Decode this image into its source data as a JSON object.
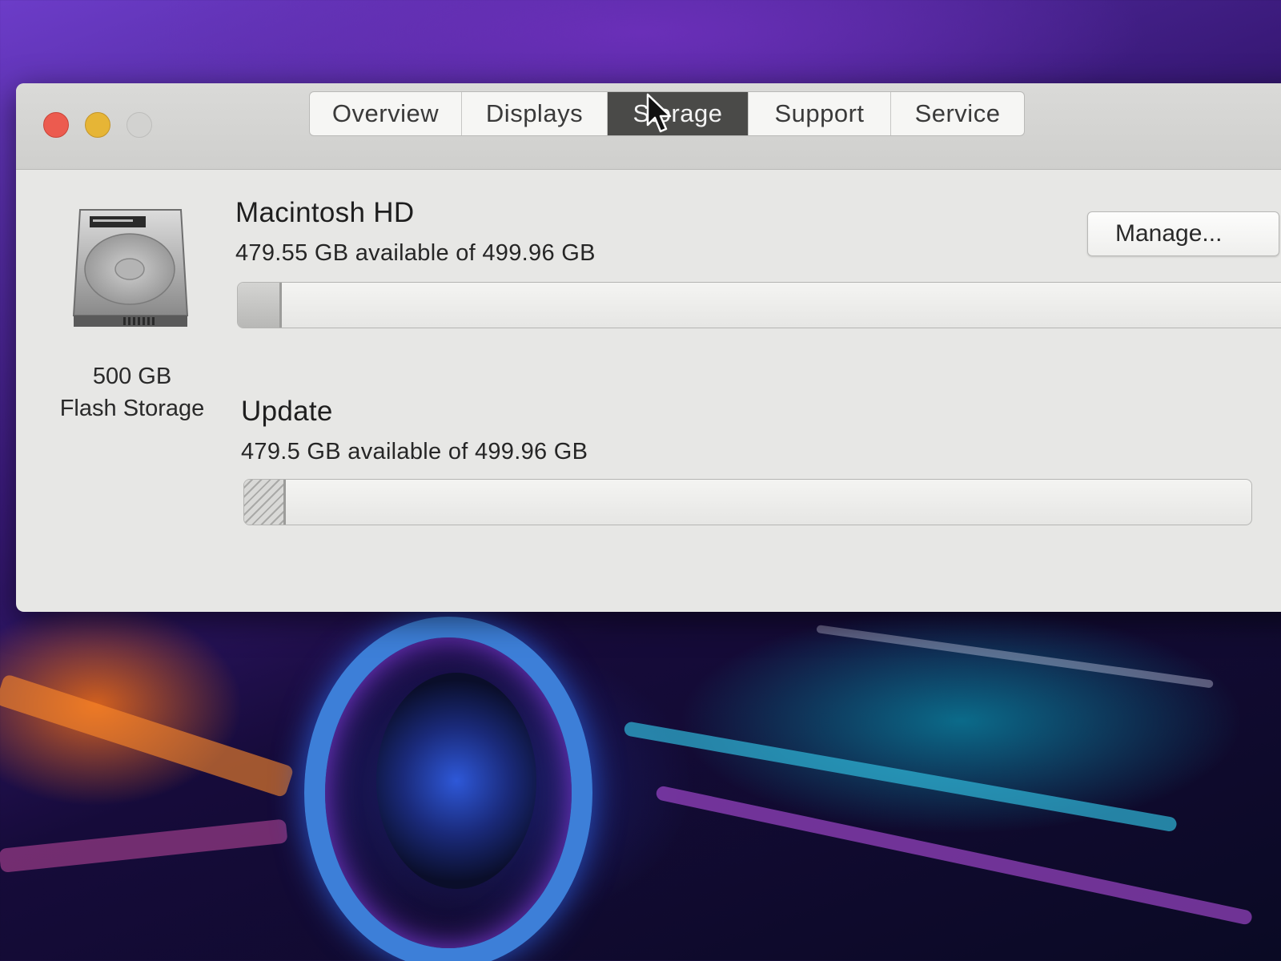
{
  "window": {
    "tabs": [
      {
        "label": "Overview",
        "active": false
      },
      {
        "label": "Displays",
        "active": false
      },
      {
        "label": "Storage",
        "active": true
      },
      {
        "label": "Support",
        "active": false
      },
      {
        "label": "Service",
        "active": false
      }
    ]
  },
  "drive": {
    "icon": "hard-drive-icon",
    "capacity": "500 GB",
    "type": "Flash Storage"
  },
  "volumes": [
    {
      "name": "Macintosh HD",
      "available_text": "479.55 GB available of 499.96 GB",
      "used_fraction": 0.041
    },
    {
      "name": "Update",
      "available_text": "479.5 GB available of 499.96 GB",
      "used_fraction": 0.041
    }
  ],
  "actions": {
    "manage_label": "Manage..."
  },
  "colors": {
    "close": "#ec5b4f",
    "minimize": "#e6b536",
    "zoom": "#d2d2d0",
    "active_tab": "#4a4a48"
  }
}
